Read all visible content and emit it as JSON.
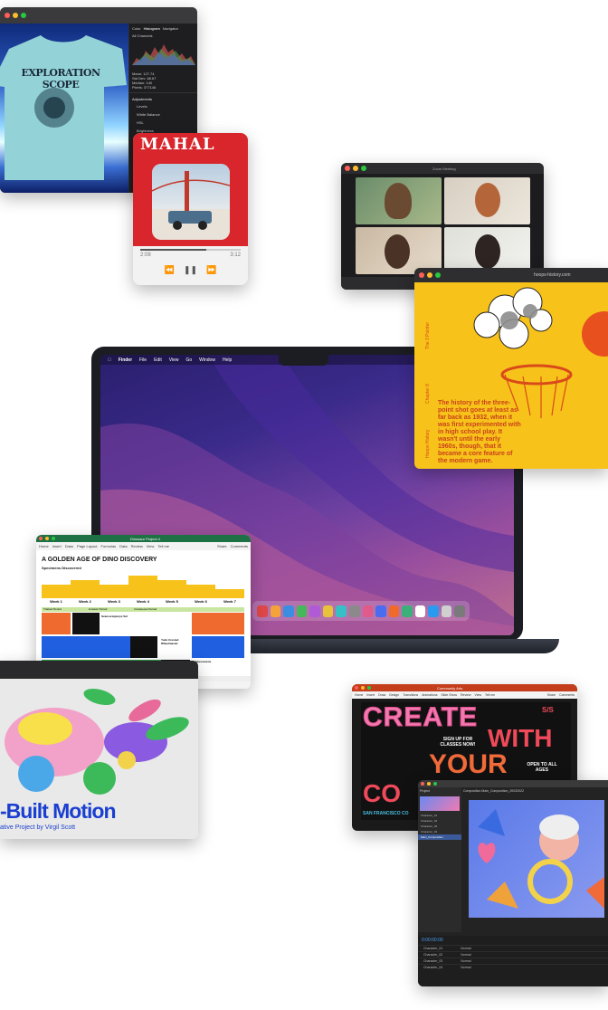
{
  "laptop": {
    "menubar": [
      "Finder",
      "File",
      "Edit",
      "View",
      "Go",
      "Window",
      "Help"
    ],
    "dock_colors": [
      "#e04848",
      "#f4a23a",
      "#3a8de0",
      "#45b85a",
      "#b05ad8",
      "#e8c23a",
      "#35c0c6",
      "#8a8a8a",
      "#e05a8a",
      "#4a6cf0",
      "#f06a2a",
      "#3ab07a",
      "#ffffff",
      "#2a9af0",
      "#d0d0d0",
      "#7a7a7a"
    ]
  },
  "photo_editor": {
    "tabs": [
      "Color",
      "Histogram",
      "Navigator"
    ],
    "panel_label": "All Channels",
    "stats": [
      "Mean: 127.74",
      "Std Dev: 68.67",
      "Median: 140",
      "Pixels: 377146"
    ],
    "adjust_title": "Adjustments",
    "adjust_items": [
      "Levels",
      "White Balance",
      "HSL",
      "Brightness"
    ],
    "shirt_text": "EXPLORATION SCOPE"
  },
  "music": {
    "title": "MAHAL",
    "time_elapsed": "2:08",
    "time_total": "3:12"
  },
  "facetime": {
    "title": "Zoom Meeting"
  },
  "browser": {
    "url": "hoops-history.com",
    "side_labels": [
      "The 3 Pointer",
      "Chapter 8",
      "Hoops History"
    ],
    "body": "The history of the three-point shot goes at least as far back as 1932, when it was first experimented with in high school play. It wasn't until the early 1960s, though, that it became a core feature of the modern game."
  },
  "spreadsheet": {
    "window_title": "Dinosaur Project 4",
    "menu": [
      "Home",
      "Insert",
      "Draw",
      "Page Layout",
      "Formulas",
      "Data",
      "Review",
      "View",
      "Tell me"
    ],
    "share": "Share",
    "comments": "Comments",
    "heading": "A GOLDEN AGE OF DINO DISCOVERY",
    "subheading": "Specimens Discovered",
    "chart_values": [
      3,
      4,
      3,
      5,
      4,
      3,
      2
    ],
    "weeks": [
      "Week 1",
      "Week 2",
      "Week 3",
      "Week 4",
      "Week 5",
      "Week 6",
      "Week 7"
    ],
    "periods": [
      "Triassic Period",
      "Jurassic Period",
      "Cretaceous Period"
    ],
    "specimens": [
      "Scansoriopteryx Sol",
      "Yudo Crested Wheelmaster",
      "Lambeosaurus"
    ],
    "sheet_tab": "Sheet1",
    "status": "Ready"
  },
  "motion": {
    "title": "-Built Motion",
    "subtitle": "ative Project by Virgil Scott"
  },
  "keynote": {
    "menu": [
      "Home",
      "Insert",
      "Draw",
      "Design",
      "Transitions",
      "Animations",
      "Slide Show",
      "Review",
      "View",
      "Tell me"
    ],
    "window_title": "Community Arts",
    "share": "Share",
    "comments": "Comments",
    "poster_lines": [
      "CREATE",
      "WITH",
      "YOUR",
      "CO"
    ],
    "season": "S/S",
    "signup": "SIGN UP FOR CLASSES NOW!",
    "open": "OPEN TO ALL AGES",
    "location": "SAN FRANCISCO CO"
  },
  "after_effects": {
    "comp_tab": "Composition Main_Composition_20032022",
    "comp_name": "Main_Composition_20032022",
    "layers": [
      "Character_01",
      "Character_02",
      "Character_03",
      "Character_04",
      "Main_Composition"
    ],
    "project": "Project",
    "timecode": "0:00:00:00",
    "blend": [
      "Normal",
      "Normal",
      "Normal",
      "Normal"
    ]
  }
}
